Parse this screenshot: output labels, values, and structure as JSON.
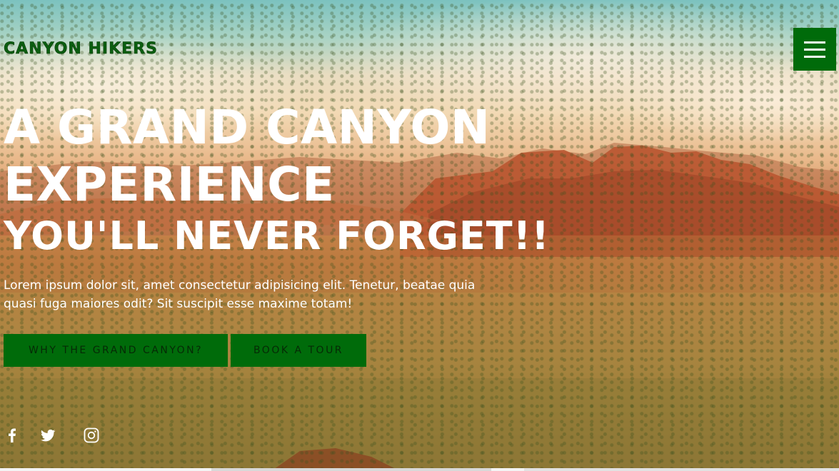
{
  "brand": {
    "logo_text": "CANYON HIKERS",
    "primary_color": "#006b0a"
  },
  "nav": {
    "menu_icon": "hamburger-icon"
  },
  "hero": {
    "headline_line1": "A GRAND CANYON",
    "headline_line2": "EXPERIENCE",
    "headline_line3": "YOU'LL NEVER FORGET!!",
    "lead": "Lorem ipsum dolor sit, amet consectetur adipisicing elit. Tenetur, beatae quia quasi fuga maiores odit? Sit suscipit esse maxime totam!",
    "buttons": {
      "why_label": "WHY THE GRAND CANYON?",
      "book_label": "BOOK A TOUR"
    }
  },
  "social": {
    "icons": [
      "facebook-icon",
      "twitter-icon",
      "instagram-icon"
    ]
  }
}
